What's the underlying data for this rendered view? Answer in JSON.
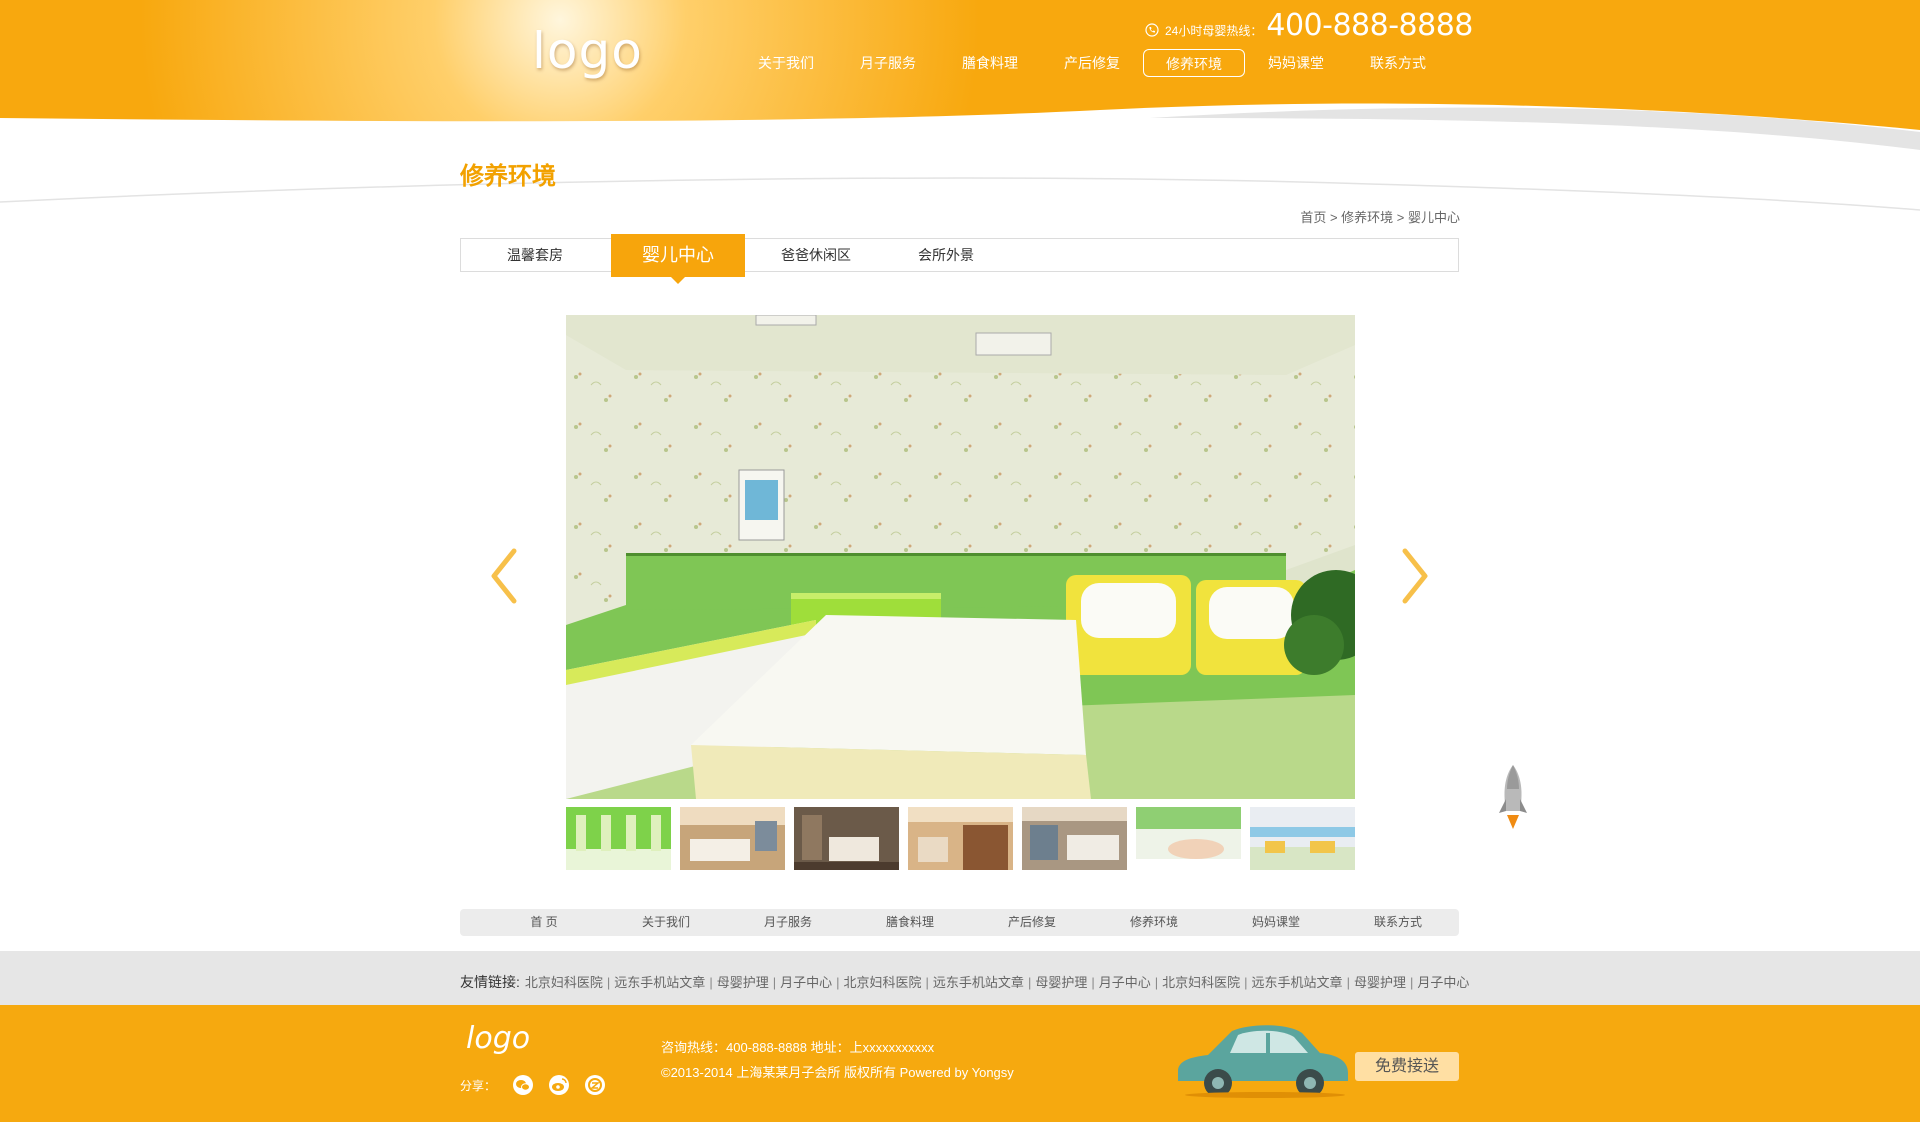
{
  "header": {
    "logo": "logo",
    "hotline_label": "24小时母婴热线：",
    "hotline_number": "400-888-8888",
    "nav": [
      {
        "label": "关于我们",
        "active": false
      },
      {
        "label": "月子服务",
        "active": false
      },
      {
        "label": "膳食料理",
        "active": false
      },
      {
        "label": "产后修复",
        "active": false
      },
      {
        "label": "修养环境",
        "active": true
      },
      {
        "label": "妈妈课堂",
        "active": false
      },
      {
        "label": "联系方式",
        "active": false
      }
    ]
  },
  "page": {
    "title": "修养环境",
    "breadcrumb": "首页 > 修养环境 > 婴儿中心"
  },
  "tabs": [
    {
      "label": "温馨套房",
      "active": false
    },
    {
      "label": "婴儿中心",
      "active": true
    },
    {
      "label": "爸爸休闲区",
      "active": false
    },
    {
      "label": "会所外景",
      "active": false
    }
  ],
  "gallery": {
    "thumb_count": 7
  },
  "bottom_nav": [
    "首 页",
    "关于我们",
    "月子服务",
    "膳食料理",
    "产后修复",
    "修养环境",
    "妈妈课堂",
    "联系方式"
  ],
  "links": {
    "label": "友情链接:",
    "items": [
      "北京妇科医院",
      "远东手机站文章",
      "母婴护理",
      "月子中心",
      "北京妇科医院",
      "远东手机站文章",
      "母婴护理",
      "月子中心",
      "北京妇科医院",
      "远东手机站文章",
      "母婴护理",
      "月子中心"
    ]
  },
  "footer": {
    "logo": "logo",
    "share_label": "分享：",
    "contact": "咨询热线：400-888-8888   地址：上xxxxxxxxxxx",
    "copyright": "©2013-2014 上海某某月子会所  版权所有 Powered by Yongsy",
    "pickup_button": "免费接送"
  },
  "colors": {
    "brand_orange": "#f7a50c",
    "title_orange": "#f2a100",
    "footer_orange": "#f6a90f"
  }
}
